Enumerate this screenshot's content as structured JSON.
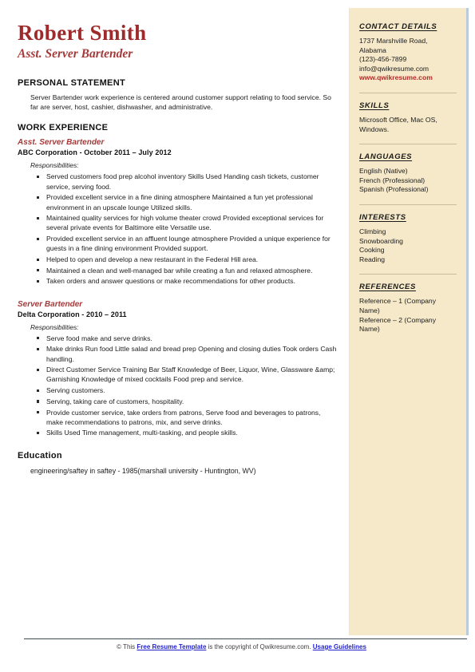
{
  "header": {
    "name": "Robert Smith",
    "role": "Asst. Server Bartender"
  },
  "sidebar": {
    "contact": {
      "heading": "CONTACT DETAILS",
      "address_line1": "1737 Marshville Road,",
      "address_line2": "Alabama",
      "phone": "(123)-456-7899",
      "email": "info@qwikresume.com",
      "website": "www.qwikresume.com"
    },
    "skills": {
      "heading": "SKILLS",
      "text": "Microsoft Office, Mac OS, Windows."
    },
    "languages": {
      "heading": "LANGUAGES",
      "items": [
        "English (Native)",
        "French (Professional)",
        "Spanish (Professional)"
      ]
    },
    "interests": {
      "heading": "INTERESTS",
      "items": [
        "Climbing",
        "Snowboarding",
        "Cooking",
        "Reading"
      ]
    },
    "references": {
      "heading": "REFERENCES",
      "items": [
        "Reference – 1 (Company Name)",
        "Reference – 2 (Company Name)"
      ]
    }
  },
  "main": {
    "personal_statement": {
      "heading": "PERSONAL STATEMENT",
      "text": "Server Bartender work experience is centered around customer support relating to food service. So far are server, host, cashier, dishwasher, and administrative."
    },
    "work_experience": {
      "heading": "WORK EXPERIENCE",
      "responsibilities_label": "Responsibilities:",
      "jobs": [
        {
          "title": "Asst. Server Bartender",
          "meta": "ABC Corporation -   October 2011 – July 2012",
          "bullets": [
            "Served customers food prep alcohol inventory Skills Used Handing cash tickets, customer service, serving food.",
            "Provided excellent service in a fine dining atmosphere Maintained a fun yet professional environment in an upscale lounge Utilized skills.",
            "Maintained quality services for high volume theater crowd Provided exceptional services for several private events for Baltimore elite Versatile use.",
            "Provided excellent service in an affluent lounge atmosphere Provided a unique experience for guests in a fine dining environment Provided support.",
            "Helped to open and develop a new restaurant in the Federal Hill area.",
            "Maintained a clean and well-managed bar while creating a fun and relaxed atmosphere.",
            "Taken orders and answer questions or make recommendations for other products."
          ]
        },
        {
          "title": "Server Bartender",
          "meta": "Delta Corporation -   2010 – 2011",
          "bullets": [
            "Serve food make and serve drinks.",
            "Make drinks Run food Little salad and bread prep Opening and closing duties Took orders Cash handling.",
            "Direct Customer Service Training Bar Staff Knowledge of Beer, Liquor, Wine, Glassware &amp; Garnishing Knowledge of mixed cocktails Food prep and service.",
            "Serving customers.",
            "Serving, taking care of customers, hospitality.",
            "Provide customer service, take orders from patrons, Serve food and beverages to patrons, make recommendations to patrons, mix, and serve drinks.",
            "Skills Used Time management, multi-tasking, and people skills."
          ]
        }
      ]
    },
    "education": {
      "heading": "Education",
      "text": "engineering/saftey in saftey - 1985(marshall university - Huntington, WV)"
    }
  },
  "footer": {
    "prefix": "© This ",
    "link1": "Free Resume Template",
    "middle": " is the copyright of Qwikresume.com. ",
    "link2": "Usage Guidelines"
  }
}
